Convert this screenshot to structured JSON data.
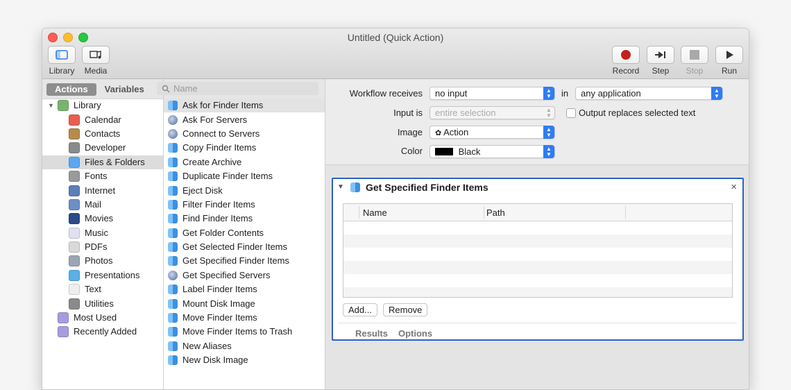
{
  "window": {
    "title": "Untitled (Quick Action)"
  },
  "toolbar": {
    "library": "Library",
    "media": "Media",
    "record": "Record",
    "step": "Step",
    "stop": "Stop",
    "run": "Run"
  },
  "library_pane": {
    "tab_actions": "Actions",
    "tab_variables": "Variables",
    "tree": [
      {
        "label": "Library",
        "color": "#7bb36e",
        "level": 0,
        "disclosure": true
      },
      {
        "label": "Calendar",
        "color": "#e85d4f",
        "level": 1
      },
      {
        "label": "Contacts",
        "color": "#b58a4c",
        "level": 1
      },
      {
        "label": "Developer",
        "color": "#8a8a8a",
        "level": 1
      },
      {
        "label": "Files & Folders",
        "color": "#5aa8f0",
        "level": 1,
        "selected": true
      },
      {
        "label": "Fonts",
        "color": "#9a9a9a",
        "level": 1
      },
      {
        "label": "Internet",
        "color": "#5a7fb6",
        "level": 1
      },
      {
        "label": "Mail",
        "color": "#6b8fc7",
        "level": 1
      },
      {
        "label": "Movies",
        "color": "#2c4a8a",
        "level": 1
      },
      {
        "label": "Music",
        "color": "#e0e0f0",
        "level": 1
      },
      {
        "label": "PDFs",
        "color": "#d9d9d9",
        "level": 1
      },
      {
        "label": "Photos",
        "color": "#9aa6b4",
        "level": 1
      },
      {
        "label": "Presentations",
        "color": "#5ab0e8",
        "level": 1
      },
      {
        "label": "Text",
        "color": "#eeeeee",
        "level": 1
      },
      {
        "label": "Utilities",
        "color": "#8a8a8a",
        "level": 1
      },
      {
        "label": "Most Used",
        "color": "#a99be0",
        "level": 0
      },
      {
        "label": "Recently Added",
        "color": "#a99be0",
        "level": 0
      }
    ]
  },
  "actions_pane": {
    "search_placeholder": "Name",
    "items": [
      {
        "label": "Ask for Finder Items",
        "kind": "f",
        "selected": true
      },
      {
        "label": "Ask For Servers",
        "kind": "s"
      },
      {
        "label": "Connect to Servers",
        "kind": "s"
      },
      {
        "label": "Copy Finder Items",
        "kind": "f"
      },
      {
        "label": "Create Archive",
        "kind": "f"
      },
      {
        "label": "Duplicate Finder Items",
        "kind": "f"
      },
      {
        "label": "Eject Disk",
        "kind": "f"
      },
      {
        "label": "Filter Finder Items",
        "kind": "f"
      },
      {
        "label": "Find Finder Items",
        "kind": "f"
      },
      {
        "label": "Get Folder Contents",
        "kind": "f"
      },
      {
        "label": "Get Selected Finder Items",
        "kind": "f"
      },
      {
        "label": "Get Specified Finder Items",
        "kind": "f"
      },
      {
        "label": "Get Specified Servers",
        "kind": "s"
      },
      {
        "label": "Label Finder Items",
        "kind": "f"
      },
      {
        "label": "Mount Disk Image",
        "kind": "f"
      },
      {
        "label": "Move Finder Items",
        "kind": "f"
      },
      {
        "label": "Move Finder Items to Trash",
        "kind": "f"
      },
      {
        "label": "New Aliases",
        "kind": "f"
      },
      {
        "label": "New Disk Image",
        "kind": "f"
      }
    ]
  },
  "workflow": {
    "receives_label": "Workflow receives",
    "receives_value": "no input",
    "in_label": "in",
    "app_value": "any application",
    "input_is_label": "Input is",
    "input_is_value": "entire selection",
    "output_replaces_label": "Output replaces selected text",
    "image_label": "Image",
    "image_value": "Action",
    "color_label": "Color",
    "color_value": "Black",
    "color_swatch": "#000000"
  },
  "action_card": {
    "title": "Get Specified Finder Items",
    "col_name": "Name",
    "col_path": "Path",
    "add_button": "Add...",
    "remove_button": "Remove",
    "results_tab": "Results",
    "options_tab": "Options",
    "border_color": "#2a62c9"
  }
}
